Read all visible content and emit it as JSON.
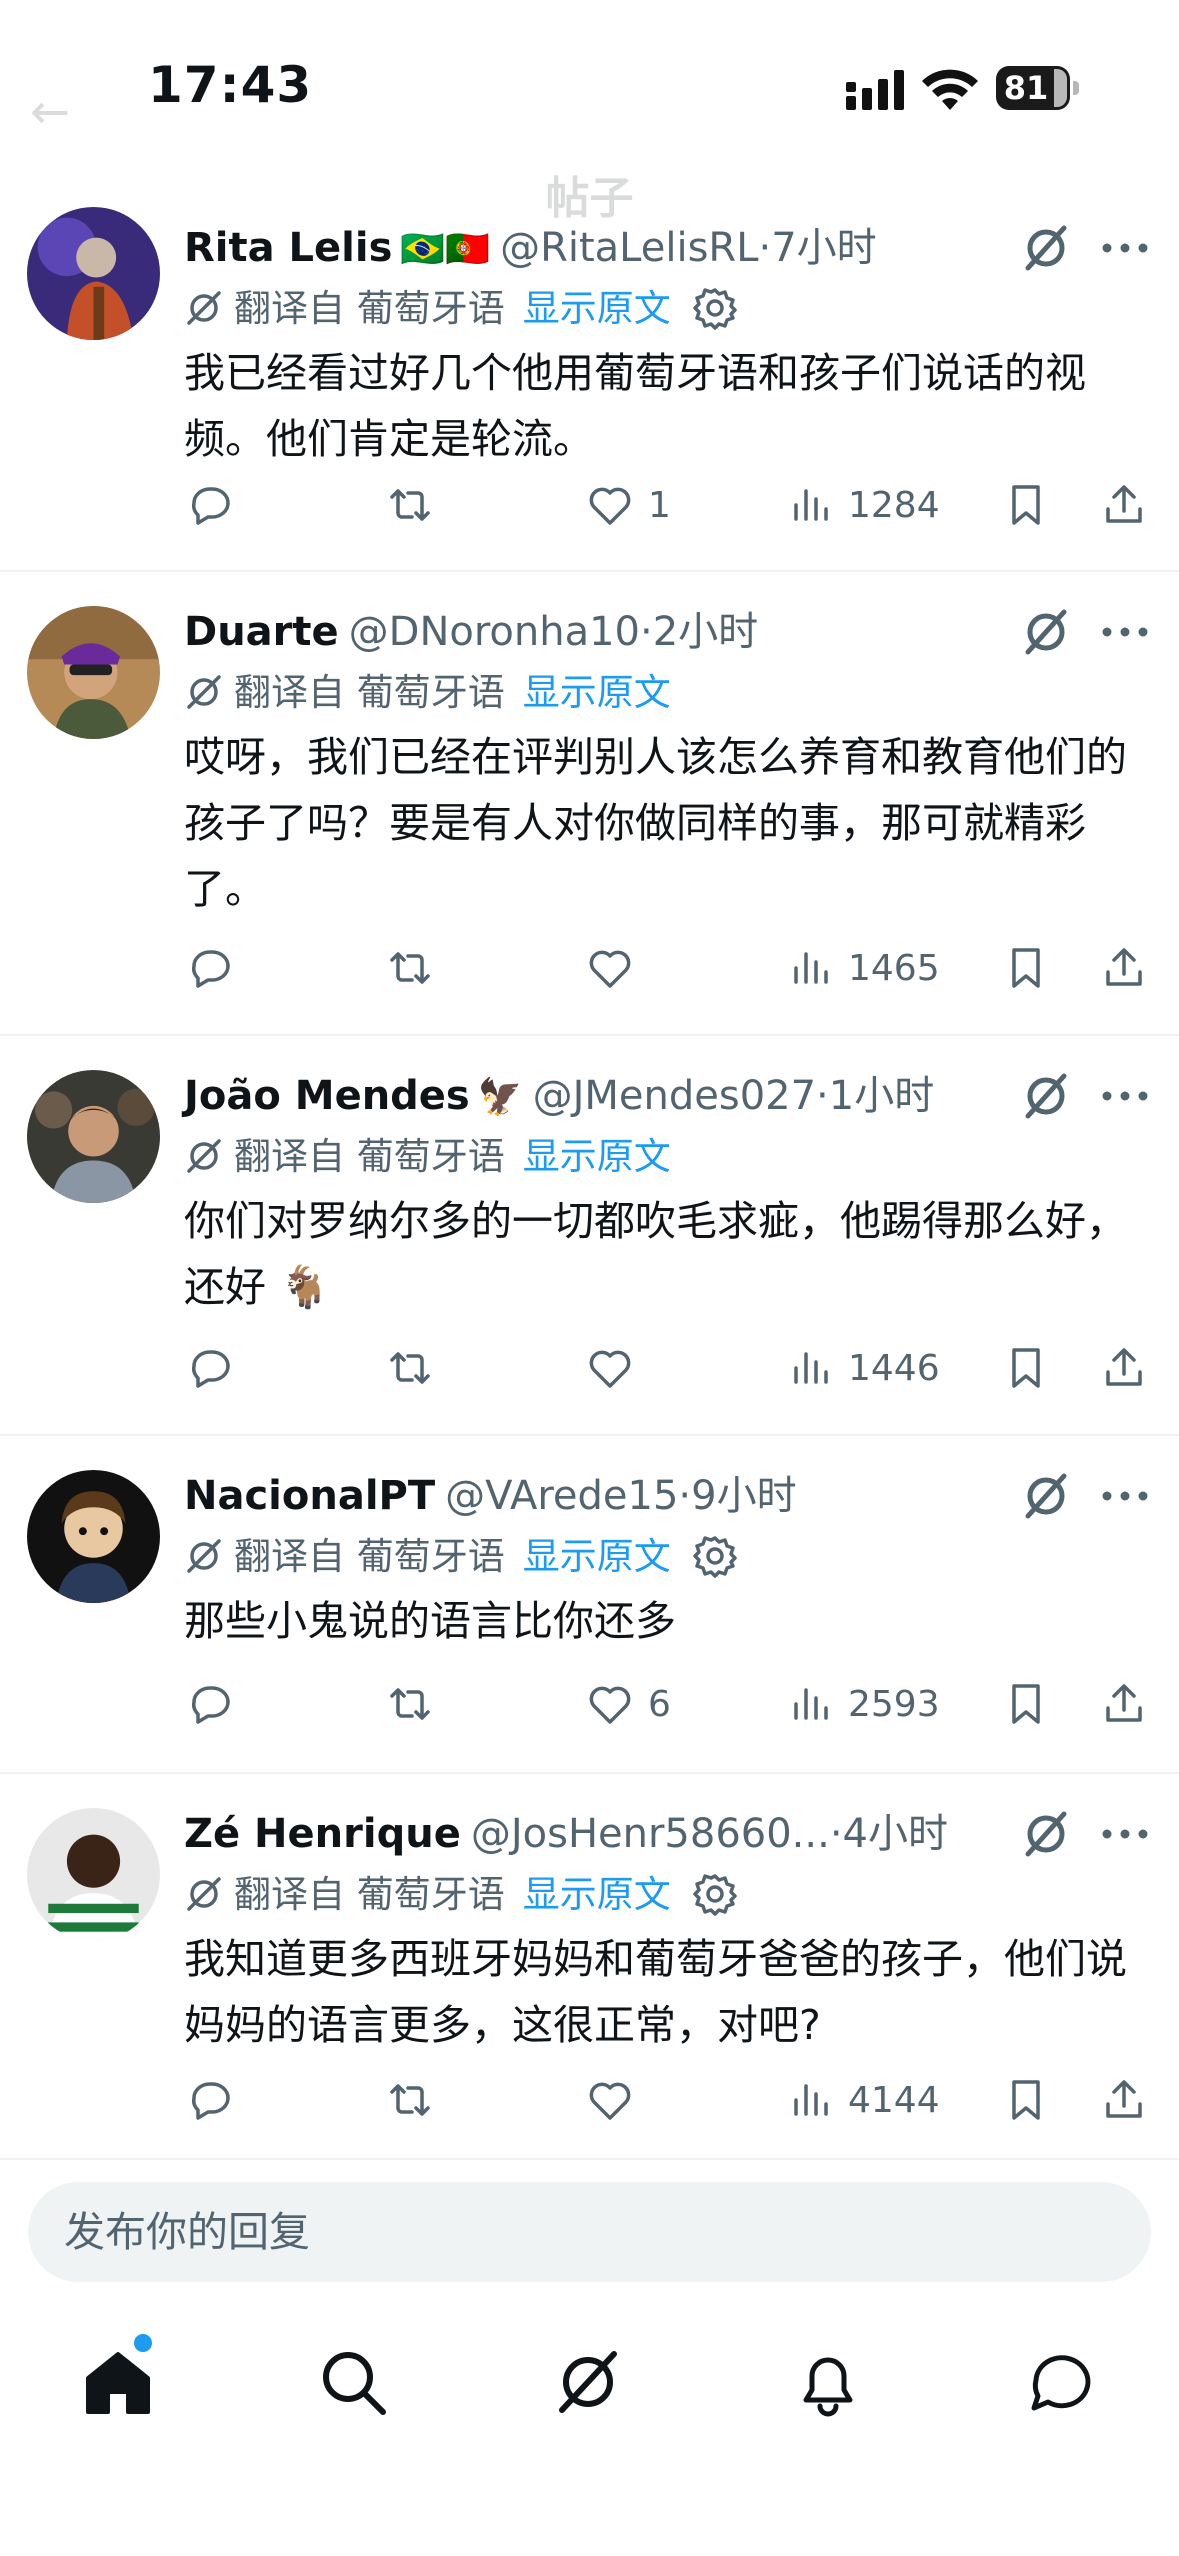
{
  "status_bar": {
    "time": "17:43",
    "battery": "81"
  },
  "header": {
    "title": "帖子"
  },
  "translation": {
    "label": "翻译自 葡萄牙语",
    "show_original": "显示原文"
  },
  "replies": [
    {
      "name": "Rita Lelis",
      "flags": "🇧🇷🇵🇹",
      "handle": "@RitaLelisRL",
      "time": "·7小时",
      "text": "我已经看过好几个他用葡萄牙语和孩子们说话的视频。他们肯定是轮流。",
      "likes": "1",
      "views": "1284",
      "has_gear": true
    },
    {
      "name": "Duarte",
      "flags": "",
      "handle": "@DNoronha10",
      "time": "·2小时",
      "text": "哎呀，我们已经在评判别人该怎么养育和教育他们的孩子了吗？要是有人对你做同样的事，那可就精彩了。",
      "likes": "",
      "views": "1465",
      "has_gear": false
    },
    {
      "name": "João Mendes",
      "flags": "🦅",
      "handle": "@JMendes027",
      "time": "·1小时",
      "text": "你们对罗纳尔多的一切都吹毛求疵，他踢得那么好，还好 🐐",
      "likes": "",
      "views": "1446",
      "has_gear": false
    },
    {
      "name": "NacionalPT",
      "flags": "",
      "handle": "@VArede15",
      "time": "·9小时",
      "text": "那些小鬼说的语言比你还多",
      "likes": "6",
      "views": "2593",
      "has_gear": true
    },
    {
      "name": "Zé Henrique",
      "flags": "",
      "handle": "@JosHenr58660...",
      "time": "·4小时",
      "text": "我知道更多西班牙妈妈和葡萄牙爸爸的孩子，他们说妈妈的语言更多，这很正常，对吧?",
      "likes": "",
      "views": "4144",
      "has_gear": true
    }
  ],
  "reply_box": {
    "placeholder": "发布你的回复"
  },
  "colors": {
    "accent": "#1d9bf0",
    "muted": "#536471",
    "text": "#0f1419",
    "divider": "#eff3f4"
  },
  "icons": [
    "grok-icon",
    "more-icon",
    "translate-icon",
    "gear-icon",
    "reply-icon",
    "retweet-icon",
    "like-icon",
    "views-icon",
    "bookmark-icon",
    "share-icon",
    "home-icon",
    "search-icon",
    "notifications-icon",
    "messages-icon"
  ]
}
